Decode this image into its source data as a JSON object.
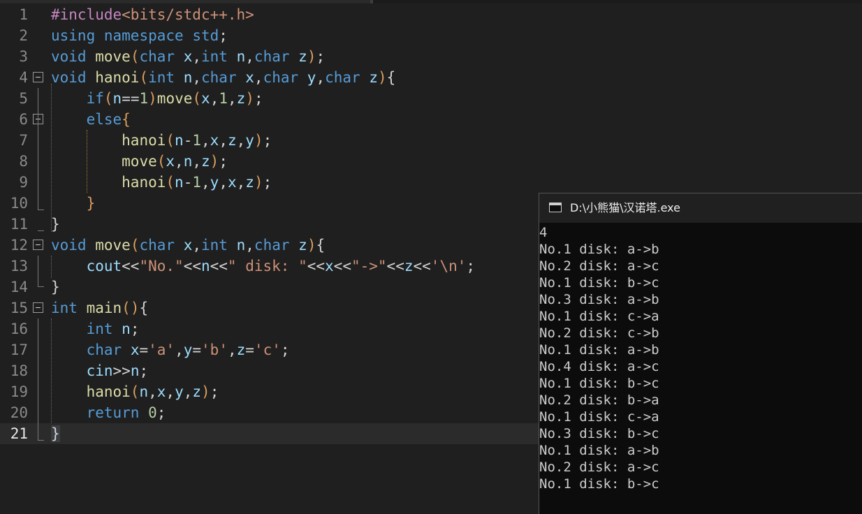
{
  "editor": {
    "current_line": 21,
    "lines": [
      {
        "n": "1",
        "tokens": [
          [
            "pp",
            "#include"
          ],
          [
            "st",
            "<bits/stdc++.h>"
          ]
        ]
      },
      {
        "n": "2",
        "tokens": [
          [
            "kw",
            "using"
          ],
          [
            "pu",
            " "
          ],
          [
            "kw",
            "namespace"
          ],
          [
            "pu",
            " "
          ],
          [
            "kw",
            "std"
          ],
          [
            "pu",
            ";"
          ]
        ]
      },
      {
        "n": "3",
        "tokens": [
          [
            "kw",
            "void"
          ],
          [
            "pu",
            " "
          ],
          [
            "fn",
            "move"
          ],
          [
            "br",
            "("
          ],
          [
            "kw",
            "char"
          ],
          [
            "pu",
            " "
          ],
          [
            "vr",
            "x"
          ],
          [
            "pu",
            ","
          ],
          [
            "kw",
            "int"
          ],
          [
            "pu",
            " "
          ],
          [
            "vr",
            "n"
          ],
          [
            "pu",
            ","
          ],
          [
            "kw",
            "char"
          ],
          [
            "pu",
            " "
          ],
          [
            "vr",
            "z"
          ],
          [
            "br",
            ")"
          ],
          [
            "pu",
            ";"
          ]
        ]
      },
      {
        "n": "4",
        "tokens": [
          [
            "kw",
            "void"
          ],
          [
            "pu",
            " "
          ],
          [
            "fn",
            "hanoi"
          ],
          [
            "br",
            "("
          ],
          [
            "kw",
            "int"
          ],
          [
            "pu",
            " "
          ],
          [
            "vr",
            "n"
          ],
          [
            "pu",
            ","
          ],
          [
            "kw",
            "char"
          ],
          [
            "pu",
            " "
          ],
          [
            "vr",
            "x"
          ],
          [
            "pu",
            ","
          ],
          [
            "kw",
            "char"
          ],
          [
            "pu",
            " "
          ],
          [
            "vr",
            "y"
          ],
          [
            "pu",
            ","
          ],
          [
            "kw",
            "char"
          ],
          [
            "pu",
            " "
          ],
          [
            "vr",
            "z"
          ],
          [
            "br",
            ")"
          ],
          [
            "pu",
            "{"
          ]
        ]
      },
      {
        "n": "5",
        "tokens": [
          [
            "pu",
            "    "
          ],
          [
            "kw",
            "if"
          ],
          [
            "br",
            "("
          ],
          [
            "vr",
            "n"
          ],
          [
            "pu",
            "=="
          ],
          [
            "nm",
            "1"
          ],
          [
            "br",
            ")"
          ],
          [
            "fn",
            "move"
          ],
          [
            "br",
            "("
          ],
          [
            "vr",
            "x"
          ],
          [
            "pu",
            ","
          ],
          [
            "nm",
            "1"
          ],
          [
            "pu",
            ","
          ],
          [
            "vr",
            "z"
          ],
          [
            "br",
            ")"
          ],
          [
            "pu",
            ";"
          ]
        ]
      },
      {
        "n": "6",
        "tokens": [
          [
            "pu",
            "    "
          ],
          [
            "kw",
            "else"
          ],
          [
            "br",
            "{"
          ]
        ]
      },
      {
        "n": "7",
        "tokens": [
          [
            "pu",
            "        "
          ],
          [
            "fn",
            "hanoi"
          ],
          [
            "br",
            "("
          ],
          [
            "vr",
            "n"
          ],
          [
            "pu",
            "-"
          ],
          [
            "nm",
            "1"
          ],
          [
            "pu",
            ","
          ],
          [
            "vr",
            "x"
          ],
          [
            "pu",
            ","
          ],
          [
            "vr",
            "z"
          ],
          [
            "pu",
            ","
          ],
          [
            "vr",
            "y"
          ],
          [
            "br",
            ")"
          ],
          [
            "pu",
            ";"
          ]
        ]
      },
      {
        "n": "8",
        "tokens": [
          [
            "pu",
            "        "
          ],
          [
            "fn",
            "move"
          ],
          [
            "br",
            "("
          ],
          [
            "vr",
            "x"
          ],
          [
            "pu",
            ","
          ],
          [
            "vr",
            "n"
          ],
          [
            "pu",
            ","
          ],
          [
            "vr",
            "z"
          ],
          [
            "br",
            ")"
          ],
          [
            "pu",
            ";"
          ]
        ]
      },
      {
        "n": "9",
        "tokens": [
          [
            "pu",
            "        "
          ],
          [
            "fn",
            "hanoi"
          ],
          [
            "br",
            "("
          ],
          [
            "vr",
            "n"
          ],
          [
            "pu",
            "-"
          ],
          [
            "nm",
            "1"
          ],
          [
            "pu",
            ","
          ],
          [
            "vr",
            "y"
          ],
          [
            "pu",
            ","
          ],
          [
            "vr",
            "x"
          ],
          [
            "pu",
            ","
          ],
          [
            "vr",
            "z"
          ],
          [
            "br",
            ")"
          ],
          [
            "pu",
            ";"
          ]
        ]
      },
      {
        "n": "10",
        "tokens": [
          [
            "pu",
            "    "
          ],
          [
            "br",
            "}"
          ]
        ]
      },
      {
        "n": "11",
        "tokens": [
          [
            "pu",
            "}"
          ]
        ]
      },
      {
        "n": "12",
        "tokens": [
          [
            "kw",
            "void"
          ],
          [
            "pu",
            " "
          ],
          [
            "fn",
            "move"
          ],
          [
            "br",
            "("
          ],
          [
            "kw",
            "char"
          ],
          [
            "pu",
            " "
          ],
          [
            "vr",
            "x"
          ],
          [
            "pu",
            ","
          ],
          [
            "kw",
            "int"
          ],
          [
            "pu",
            " "
          ],
          [
            "vr",
            "n"
          ],
          [
            "pu",
            ","
          ],
          [
            "kw",
            "char"
          ],
          [
            "pu",
            " "
          ],
          [
            "vr",
            "z"
          ],
          [
            "br",
            ")"
          ],
          [
            "pu",
            "{"
          ]
        ]
      },
      {
        "n": "13",
        "tokens": [
          [
            "pu",
            "    "
          ],
          [
            "vr",
            "cout"
          ],
          [
            "pu",
            "<<"
          ],
          [
            "st",
            "\"No.\""
          ],
          [
            "pu",
            "<<"
          ],
          [
            "vr",
            "n"
          ],
          [
            "pu",
            "<<"
          ],
          [
            "st",
            "\" disk: \""
          ],
          [
            "pu",
            "<<"
          ],
          [
            "vr",
            "x"
          ],
          [
            "pu",
            "<<"
          ],
          [
            "st",
            "\"->\""
          ],
          [
            "pu",
            "<<"
          ],
          [
            "vr",
            "z"
          ],
          [
            "pu",
            "<<"
          ],
          [
            "st",
            "'\\n'"
          ],
          [
            "pu",
            ";"
          ]
        ]
      },
      {
        "n": "14",
        "tokens": [
          [
            "pu",
            "}"
          ]
        ]
      },
      {
        "n": "15",
        "tokens": [
          [
            "kw",
            "int"
          ],
          [
            "pu",
            " "
          ],
          [
            "fn",
            "main"
          ],
          [
            "br",
            "()"
          ],
          [
            "pu",
            "{"
          ]
        ]
      },
      {
        "n": "16",
        "tokens": [
          [
            "pu",
            "    "
          ],
          [
            "kw",
            "int"
          ],
          [
            "pu",
            " "
          ],
          [
            "vr",
            "n"
          ],
          [
            "pu",
            ";"
          ]
        ]
      },
      {
        "n": "17",
        "tokens": [
          [
            "pu",
            "    "
          ],
          [
            "kw",
            "char"
          ],
          [
            "pu",
            " "
          ],
          [
            "vr",
            "x"
          ],
          [
            "pu",
            "="
          ],
          [
            "st",
            "'a'"
          ],
          [
            "pu",
            ","
          ],
          [
            "vr",
            "y"
          ],
          [
            "pu",
            "="
          ],
          [
            "st",
            "'b'"
          ],
          [
            "pu",
            ","
          ],
          [
            "vr",
            "z"
          ],
          [
            "pu",
            "="
          ],
          [
            "st",
            "'c'"
          ],
          [
            "pu",
            ";"
          ]
        ]
      },
      {
        "n": "18",
        "tokens": [
          [
            "pu",
            "    "
          ],
          [
            "vr",
            "cin"
          ],
          [
            "pu",
            ">>"
          ],
          [
            "vr",
            "n"
          ],
          [
            "pu",
            ";"
          ]
        ]
      },
      {
        "n": "19",
        "tokens": [
          [
            "pu",
            "    "
          ],
          [
            "fn",
            "hanoi"
          ],
          [
            "br",
            "("
          ],
          [
            "vr",
            "n"
          ],
          [
            "pu",
            ","
          ],
          [
            "vr",
            "x"
          ],
          [
            "pu",
            ","
          ],
          [
            "vr",
            "y"
          ],
          [
            "pu",
            ","
          ],
          [
            "vr",
            "z"
          ],
          [
            "br",
            ")"
          ],
          [
            "pu",
            ";"
          ]
        ]
      },
      {
        "n": "20",
        "tokens": [
          [
            "pu",
            "    "
          ],
          [
            "kw",
            "return"
          ],
          [
            "pu",
            " "
          ],
          [
            "nm",
            "0"
          ],
          [
            "pu",
            ";"
          ]
        ]
      },
      {
        "n": "21",
        "tokens": [
          [
            "pu",
            "}"
          ]
        ]
      }
    ]
  },
  "console": {
    "title": "D:\\小熊猫\\汉诺塔.exe",
    "output": [
      "4",
      "No.1 disk: a->b",
      "No.2 disk: a->c",
      "No.1 disk: b->c",
      "No.3 disk: a->b",
      "No.1 disk: c->a",
      "No.2 disk: c->b",
      "No.1 disk: a->b",
      "No.4 disk: a->c",
      "No.1 disk: b->c",
      "No.2 disk: b->a",
      "No.1 disk: c->a",
      "No.3 disk: b->c",
      "No.1 disk: a->b",
      "No.2 disk: a->c",
      "No.1 disk: b->c"
    ]
  },
  "colors": {
    "editor_bg": "#1f1f1f",
    "keyword": "#569cd6",
    "function": "#dcdcaa",
    "variable": "#9cdcfe",
    "string": "#ce9178",
    "number": "#b5cea8",
    "preprocessor": "#c586c0",
    "console_bg": "#0c0c0c"
  }
}
